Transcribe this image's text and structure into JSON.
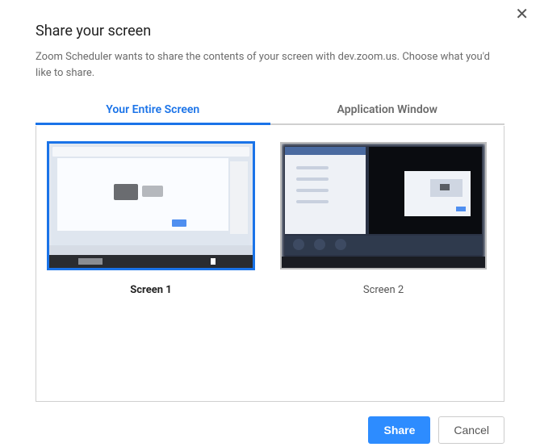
{
  "dialog": {
    "title": "Share your screen",
    "description": "Zoom Scheduler wants to share the contents of your screen with dev.zoom.us. Choose what you'd like to share."
  },
  "tabs": {
    "entire": "Your Entire Screen",
    "app": "Application Window"
  },
  "screens": {
    "s1": "Screen 1",
    "s2": "Screen 2"
  },
  "actions": {
    "share": "Share",
    "cancel": "Cancel"
  },
  "icons": {
    "close": "✕"
  }
}
